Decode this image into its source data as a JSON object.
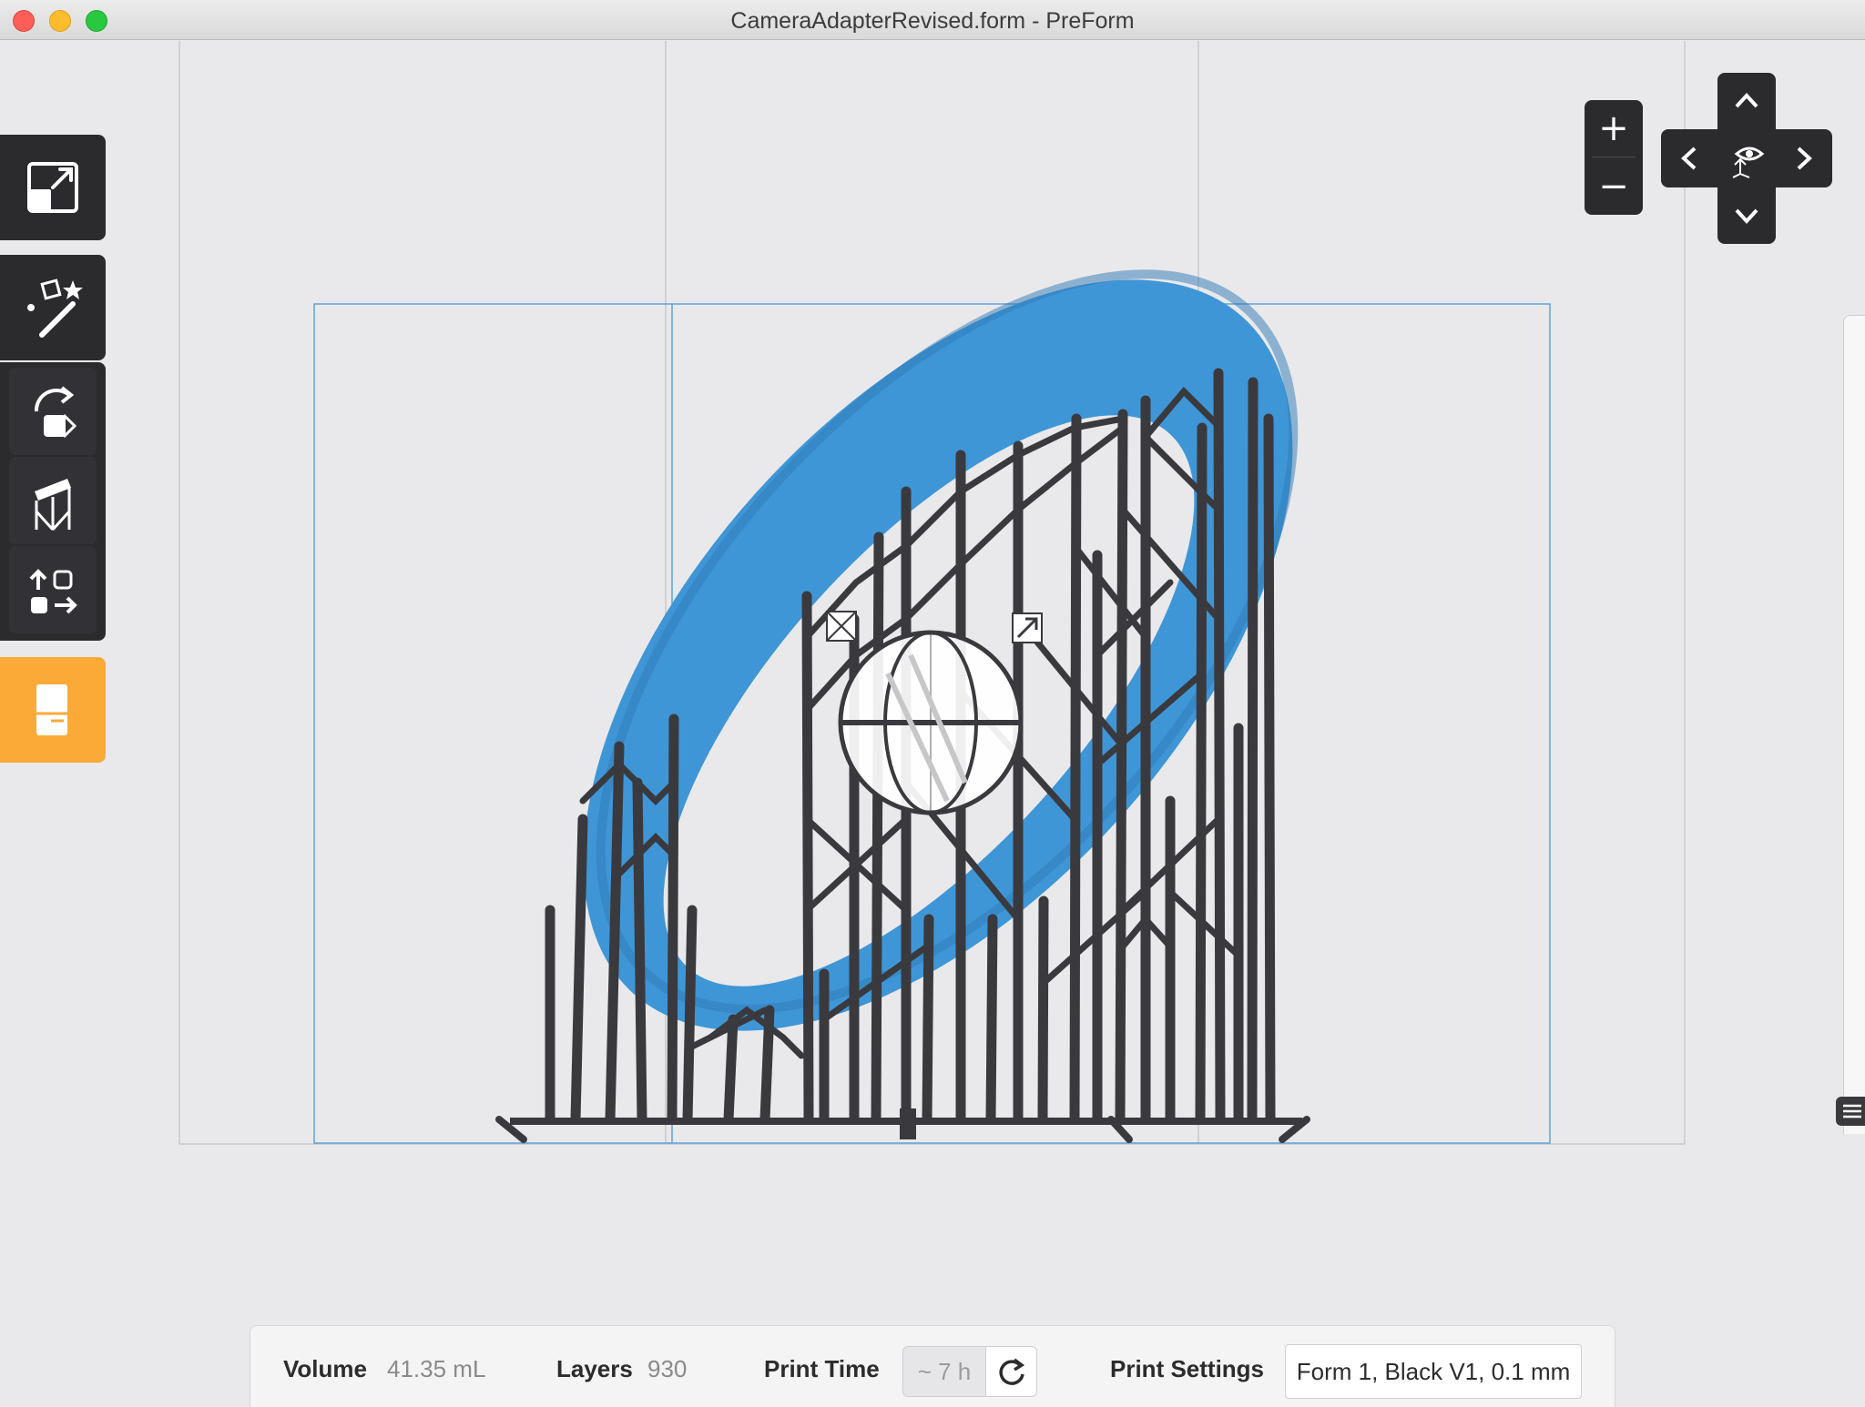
{
  "window": {
    "title": "CameraAdapterRevised.form - PreForm"
  },
  "toolbar": {
    "tools": [
      {
        "icon": "scale-icon"
      },
      {
        "icon": "magic-wand-icon"
      },
      {
        "icon": "orient-icon"
      },
      {
        "icon": "supports-icon"
      },
      {
        "icon": "layout-icon"
      },
      {
        "icon": "print-icon"
      }
    ],
    "active_color": "#fbaa37"
  },
  "zoom": {
    "in_label": "+",
    "out_label": "−"
  },
  "status": {
    "volume_label": "Volume",
    "volume_value": "41.35 mL",
    "layers_label": "Layers",
    "layers_value": "930",
    "print_time_label": "Print Time",
    "print_time_value": "~ 7 h",
    "print_settings_label": "Print Settings",
    "print_settings_value": "Form 1, Black V1, 0.1 mm"
  },
  "colors": {
    "model_blue": "#3f96d6",
    "support_gray": "#3a3a3e",
    "build_volume": "#5ea3dc"
  }
}
